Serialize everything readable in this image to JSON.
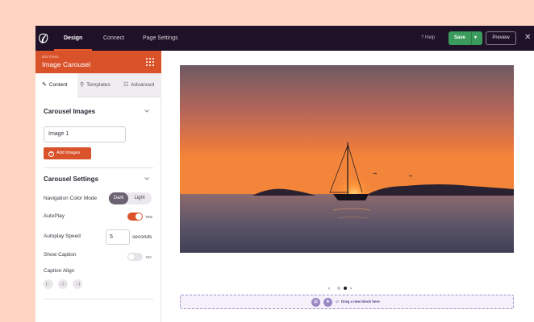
{
  "topbar": {
    "tabs": [
      "Design",
      "Connect",
      "Page Settings"
    ],
    "help_label": "Help",
    "save_label": "Save",
    "preview_label": "Preview",
    "close_glyph": "✕"
  },
  "sidebar": {
    "editing_label": "EDITING",
    "block_title": "Image Carousel",
    "tabs": [
      {
        "label": "Content",
        "icon": "pencil-icon",
        "active": true
      },
      {
        "label": "Templates",
        "icon": "paint-roller-icon",
        "active": false
      },
      {
        "label": "Advanced",
        "icon": "sliders-icon",
        "active": false
      }
    ],
    "carousel_images": {
      "title": "Carousel Images",
      "image_value": "Image 1",
      "add_button": "Add Images"
    },
    "carousel_settings": {
      "title": "Carousel Settings",
      "nav_color_mode_label": "Navigation Color Mode",
      "nav_color_options": [
        "Dark",
        "Light"
      ],
      "nav_color_selected": "Dark",
      "autoplay_label": "AutoPlay",
      "autoplay_state": "YES",
      "autoplay_speed_label": "Autoplay Speed",
      "autoplay_speed_value": "5",
      "autoplay_speed_unit": "seconds",
      "show_caption_label": "Show Caption",
      "show_caption_state": "NO",
      "caption_align_label": "Caption Align",
      "caption_align_options": [
        "left-align-icon",
        "center-align-icon",
        "right-align-icon"
      ]
    }
  },
  "canvas": {
    "carousel": {
      "slide_count": 2,
      "active_slide": 2
    },
    "dropzone": {
      "or_label": "or",
      "text": "Drag a new block here"
    }
  },
  "colors": {
    "topbar_bg": "#1f1127",
    "accent_orange": "#d9522a",
    "save_green": "#3a9b5c",
    "page_bg": "#fdd3c2",
    "dropzone_border": "#a48fc9"
  }
}
